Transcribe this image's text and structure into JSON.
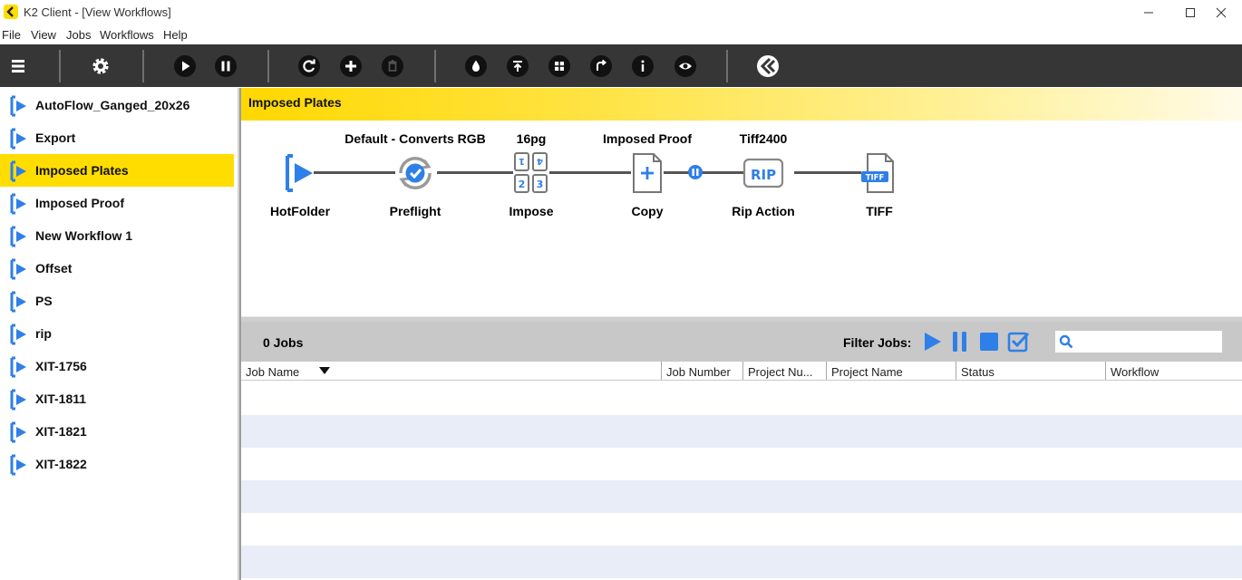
{
  "window": {
    "title": "K2 Client - [View Workflows]"
  },
  "menu": [
    "File",
    "View",
    "Jobs",
    "Workflows",
    "Help"
  ],
  "toolbar": {
    "icons": [
      "menu-icon",
      "settings-icon",
      "play-icon",
      "pause-icon",
      "refresh-icon",
      "add-icon",
      "delete-icon",
      "ink-icon",
      "upload-icon",
      "grid-icon",
      "redirect-icon",
      "info-icon",
      "view-icon",
      "brand-logo"
    ]
  },
  "sidebar": {
    "items": [
      {
        "label": "AutoFlow_Ganged_20x26",
        "selected": false
      },
      {
        "label": "Export",
        "selected": false
      },
      {
        "label": "Imposed Plates",
        "selected": true
      },
      {
        "label": "Imposed Proof",
        "selected": false
      },
      {
        "label": "New Workflow 1",
        "selected": false
      },
      {
        "label": "Offset",
        "selected": false
      },
      {
        "label": "PS",
        "selected": false
      },
      {
        "label": "rip",
        "selected": false
      },
      {
        "label": "XIT-1756",
        "selected": false
      },
      {
        "label": "XIT-1811",
        "selected": false
      },
      {
        "label": "XIT-1821",
        "selected": false
      },
      {
        "label": "XIT-1822",
        "selected": false
      }
    ]
  },
  "workflow": {
    "title": "Imposed Plates",
    "nodes": [
      {
        "name": "HotFolder",
        "config": "",
        "icon": "hotfolder-icon"
      },
      {
        "name": "Preflight",
        "config": "Default - Converts RGB",
        "icon": "preflight-icon"
      },
      {
        "name": "Impose",
        "config": "16pg",
        "icon": "impose-icon"
      },
      {
        "name": "Copy",
        "config": "Imposed Proof",
        "icon": "copy-icon"
      },
      {
        "name": "Rip Action",
        "config": "Tiff2400",
        "icon": "rip-icon"
      },
      {
        "name": "TIFF",
        "config": "",
        "icon": "tiff-icon"
      }
    ],
    "rip_badge": "RIP",
    "tiff_badge": "TIFF"
  },
  "jobs": {
    "count_label": "0 Jobs",
    "filter_label": "Filter Jobs:",
    "search_placeholder": "",
    "columns": [
      "Job Name",
      "Job Number",
      "Project Nu...",
      "Project Name",
      "Status",
      "Workflow"
    ],
    "rows": []
  },
  "colors": {
    "accent": "#ffdd00",
    "toolbar": "#363636",
    "icon_blue": "#2f7fe8",
    "alt_row": "#e9edf7"
  }
}
